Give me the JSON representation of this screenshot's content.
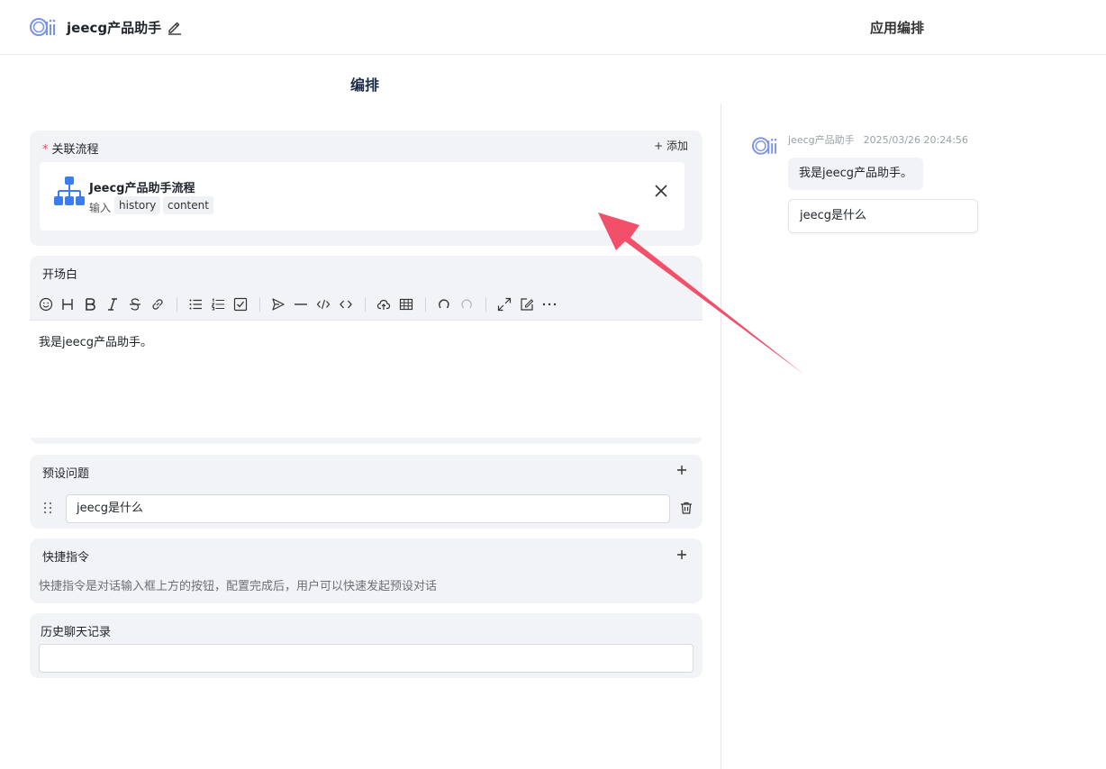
{
  "header": {
    "app_title": "jeecg产品助手",
    "right_title": "应用编排"
  },
  "main": {
    "section_title": "编排",
    "flow_card": {
      "label": "关联流程",
      "required_mark": "*",
      "add_label": "+ 添加",
      "flow_name": "Jeecg产品助手流程",
      "input_label": "输入",
      "input_tags": [
        "history",
        "content"
      ]
    },
    "opening_card": {
      "label": "开场白",
      "content": "我是jeecg产品助手。"
    },
    "preset_card": {
      "label": "预设问题",
      "questions": [
        "jeecg是什么"
      ]
    },
    "shortcut_card": {
      "label": "快捷指令",
      "hint": "快捷指令是对话输入框上方的按钮，配置完成后，用户可以快速发起预设对话"
    },
    "history_card": {
      "label": "历史聊天记录",
      "value": ""
    }
  },
  "preview": {
    "sender": "jeecg产品助手",
    "timestamp": "2025/03/26 20:24:56",
    "message": "我是jeecg产品助手。",
    "suggestion": "jeecg是什么"
  },
  "colors": {
    "accent_blue": "#3b7cf0",
    "required_red": "#e34d59",
    "annotation_arrow": "#f2506a"
  }
}
